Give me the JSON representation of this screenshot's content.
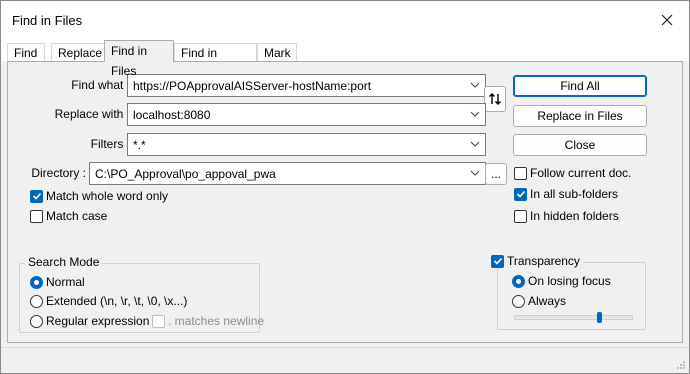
{
  "window": {
    "title": "Find in Files"
  },
  "tabs": [
    {
      "label": "Find"
    },
    {
      "label": "Replace"
    },
    {
      "label": "Find in Files"
    },
    {
      "label": "Find in Projects"
    },
    {
      "label": "Mark"
    }
  ],
  "fields": {
    "find_what": {
      "label": "Find what :",
      "value": "https://POApprovalAISServer-hostName:port"
    },
    "replace_with": {
      "label": "Replace with :",
      "value": "localhost:8080"
    },
    "filters": {
      "label": "Filters :",
      "value": "*.*"
    },
    "directory": {
      "label": "Directory :",
      "value": "C:\\PO_Approval\\po_appoval_pwa"
    }
  },
  "swap_button": {
    "icon": "swap-arrows-icon"
  },
  "browse_button": {
    "label": "..."
  },
  "buttons": {
    "find_all": "Find All",
    "replace_in_files": "Replace in Files",
    "close": "Close"
  },
  "options": {
    "match_whole_word": {
      "label": "Match whole word only",
      "checked": true
    },
    "match_case": {
      "label": "Match case",
      "checked": false
    },
    "follow_current_doc": {
      "label": "Follow current doc.",
      "checked": false
    },
    "in_all_subfolders": {
      "label": "In all sub-folders",
      "checked": true
    },
    "in_hidden_folders": {
      "label": "In hidden folders",
      "checked": false
    }
  },
  "search_mode": {
    "title": "Search Mode",
    "normal": "Normal",
    "extended": "Extended (\\n, \\r, \\t, \\0, \\x...)",
    "regex": "Regular expression",
    "matches_newline": ". matches newline",
    "selected": "normal"
  },
  "transparency": {
    "title": "Transparency",
    "checked": true,
    "on_losing_focus": "On losing focus",
    "always": "Always",
    "selected": "on_losing_focus",
    "level": 0.72
  },
  "colors": {
    "accent": "#0067c0",
    "default_button_border": "#0a64d6"
  }
}
